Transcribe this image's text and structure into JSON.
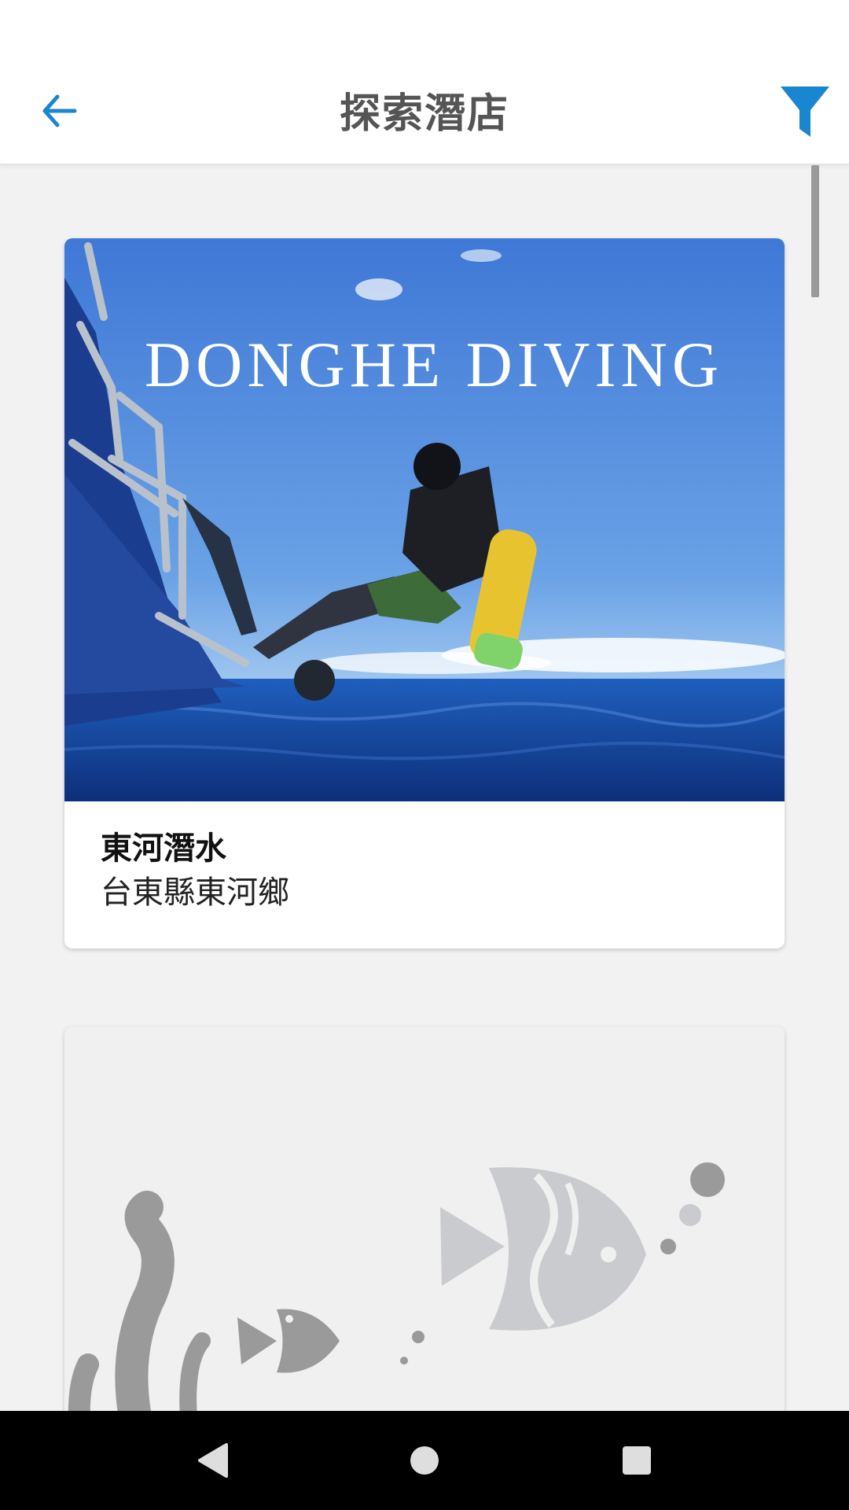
{
  "header": {
    "title": "探索潛店",
    "back_icon": "arrow-left-icon",
    "filter_icon": "filter-icon",
    "accent_color": "#1a86d0"
  },
  "shops": [
    {
      "name": "東河潛水",
      "location": "台東縣東河鄉",
      "image_caption": "DONGHE DIVING"
    },
    {
      "placeholder_icon": "fish-placeholder-icon"
    }
  ],
  "navbar": {
    "back_icon": "triangle-back-icon",
    "home_icon": "circle-home-icon",
    "recents_icon": "square-recents-icon"
  }
}
